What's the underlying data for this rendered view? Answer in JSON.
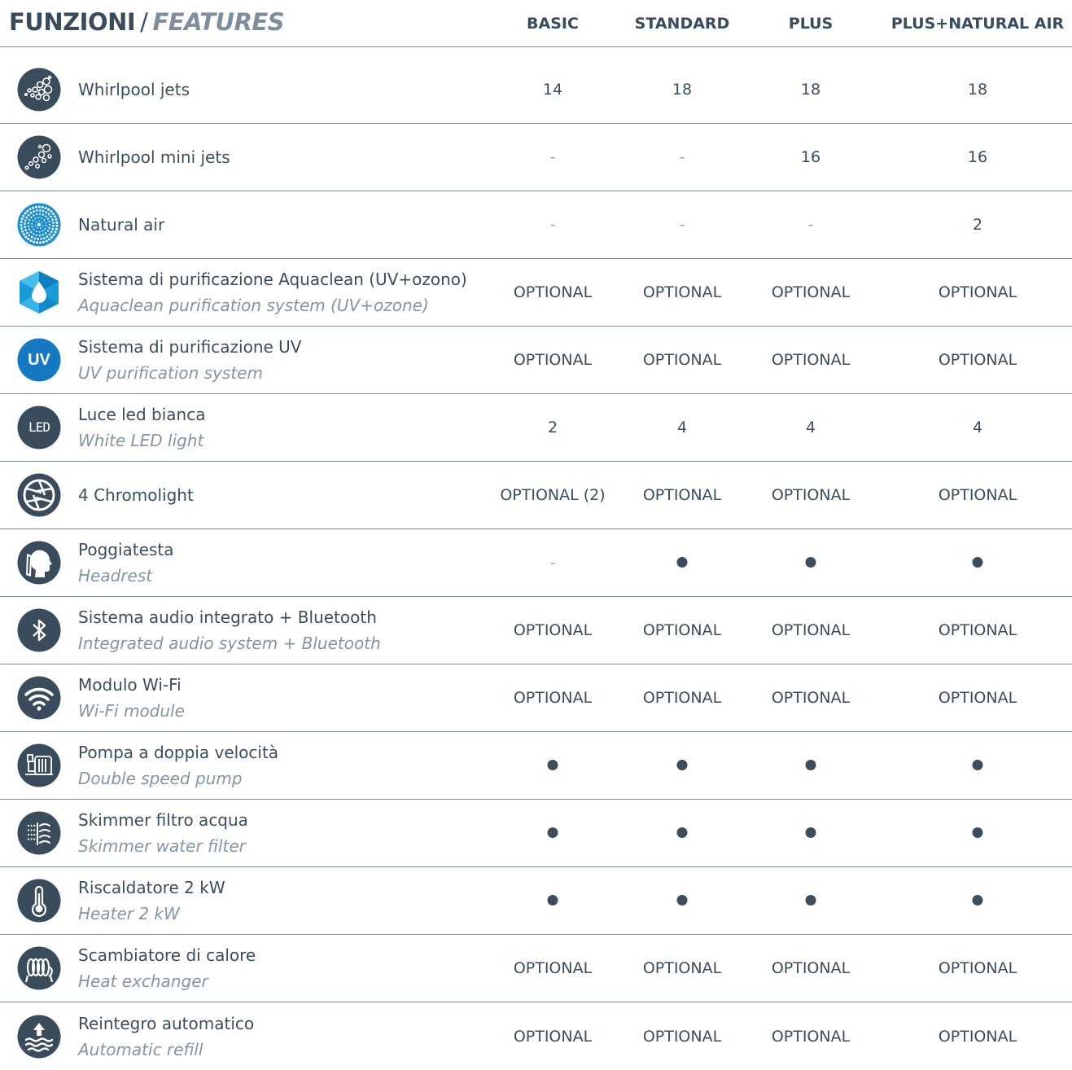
{
  "header": {
    "title_it": "FUNZIONI",
    "slash": "/",
    "title_en": "FEATURES",
    "columns": [
      "BASIC",
      "STANDARD",
      "PLUS",
      "PLUS+NATURAL AIR"
    ]
  },
  "rows": [
    {
      "icon": "whirlpool-jets-icon",
      "it": "Whirlpool jets",
      "en": "",
      "values": [
        "14",
        "18",
        "18",
        "18"
      ]
    },
    {
      "icon": "whirlpool-mini-jets-icon",
      "it": "Whirlpool mini jets",
      "en": "",
      "values": [
        "-",
        "-",
        "16",
        "16"
      ]
    },
    {
      "icon": "natural-air-icon",
      "it": "Natural air",
      "en": "",
      "values": [
        "-",
        "-",
        "-",
        "2"
      ]
    },
    {
      "icon": "aquaclean-drop-icon",
      "it": "Sistema di purificazione Aquaclean (UV+ozono)",
      "en": "Aquaclean purification system (UV+ozone)",
      "values": [
        "OPTIONAL",
        "OPTIONAL",
        "OPTIONAL",
        "OPTIONAL"
      ]
    },
    {
      "icon": "uv-icon",
      "icon_text": "UV",
      "it": "Sistema di purificazione UV",
      "en": "UV purification system",
      "values": [
        "OPTIONAL",
        "OPTIONAL",
        "OPTIONAL",
        "OPTIONAL"
      ]
    },
    {
      "icon": "led-icon",
      "icon_text": "LED",
      "it": "Luce led bianca",
      "en": "White LED light",
      "values": [
        "2",
        "4",
        "4",
        "4"
      ]
    },
    {
      "icon": "chromolight-aperture-icon",
      "it": "4 Chromolight",
      "en": "",
      "values": [
        "OPTIONAL (2)",
        "OPTIONAL",
        "OPTIONAL",
        "OPTIONAL"
      ]
    },
    {
      "icon": "headrest-icon",
      "it": "Poggiatesta",
      "en": "Headrest",
      "values": [
        "-",
        "●",
        "●",
        "●"
      ]
    },
    {
      "icon": "bluetooth-icon",
      "it": "Sistema audio integrato + Bluetooth",
      "en": "Integrated audio system + Bluetooth",
      "values": [
        "OPTIONAL",
        "OPTIONAL",
        "OPTIONAL",
        "OPTIONAL"
      ]
    },
    {
      "icon": "wifi-icon",
      "it": "Modulo Wi-Fi",
      "en": "Wi-Fi module",
      "values": [
        "OPTIONAL",
        "OPTIONAL",
        "OPTIONAL",
        "OPTIONAL"
      ]
    },
    {
      "icon": "pump-icon",
      "it": "Pompa a doppia velocità",
      "en": "Double speed pump",
      "values": [
        "●",
        "●",
        "●",
        "●"
      ]
    },
    {
      "icon": "skimmer-filter-icon",
      "it": "Skimmer filtro acqua",
      "en": "Skimmer water filter",
      "values": [
        "●",
        "●",
        "●",
        "●"
      ]
    },
    {
      "icon": "thermometer-icon",
      "it": "Riscaldatore 2 kW",
      "en": "Heater 2 kW",
      "values": [
        "●",
        "●",
        "●",
        "●"
      ]
    },
    {
      "icon": "heat-exchanger-coil-icon",
      "it": "Scambiatore di calore",
      "en": "Heat exchanger",
      "values": [
        "OPTIONAL",
        "OPTIONAL",
        "OPTIONAL",
        "OPTIONAL"
      ]
    },
    {
      "icon": "refill-water-icon",
      "it": "Reintegro automatico",
      "en": "Automatic refill",
      "values": [
        "OPTIONAL",
        "OPTIONAL",
        "OPTIONAL",
        "OPTIONAL"
      ]
    }
  ],
  "colors": {
    "text": "#3d4d5c",
    "italic": "#8795a2",
    "rule": "#7d8a97",
    "icon_dark": "#3a4b5c",
    "icon_blue": "#1a8fd1"
  }
}
